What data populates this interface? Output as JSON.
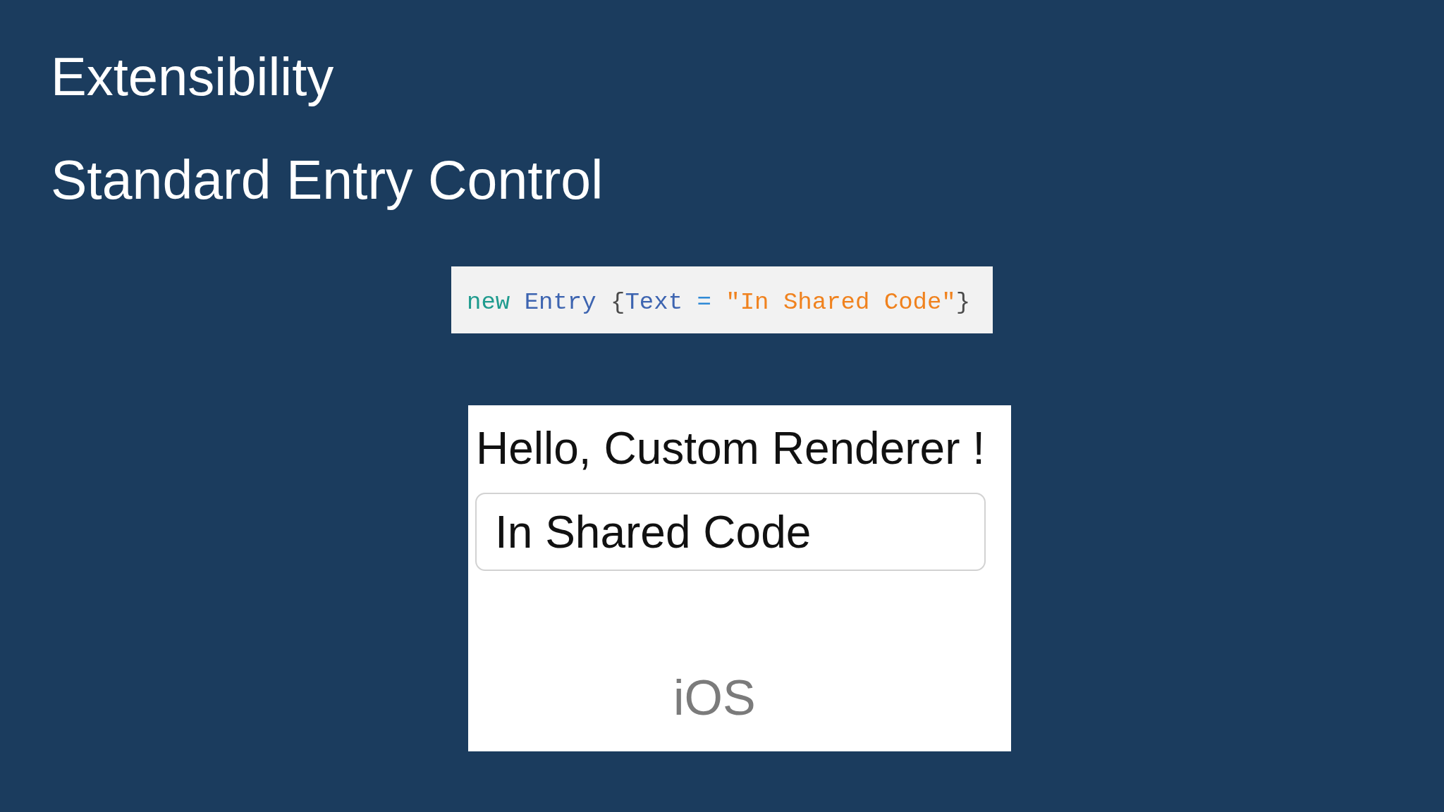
{
  "slide": {
    "title": "Extensibility",
    "subtitle": "Standard Entry Control",
    "code": {
      "tokens": [
        {
          "text": "new",
          "kind": "keyword",
          "space_after": true
        },
        {
          "text": "Entry",
          "kind": "type",
          "space_after": true
        },
        {
          "text": "{",
          "kind": "punctuation",
          "space_after": false
        },
        {
          "text": "Text",
          "kind": "property",
          "space_after": true
        },
        {
          "text": "=",
          "kind": "operator",
          "space_after": true
        },
        {
          "text": "\"In Shared Code\"",
          "kind": "string",
          "space_after": false
        },
        {
          "text": "}",
          "kind": "punctuation",
          "space_after": false
        }
      ]
    },
    "phone_screen": {
      "label": "Hello, Custom Renderer !",
      "entry": {
        "value": "In Shared Code"
      },
      "platform_caption": "iOS"
    }
  }
}
